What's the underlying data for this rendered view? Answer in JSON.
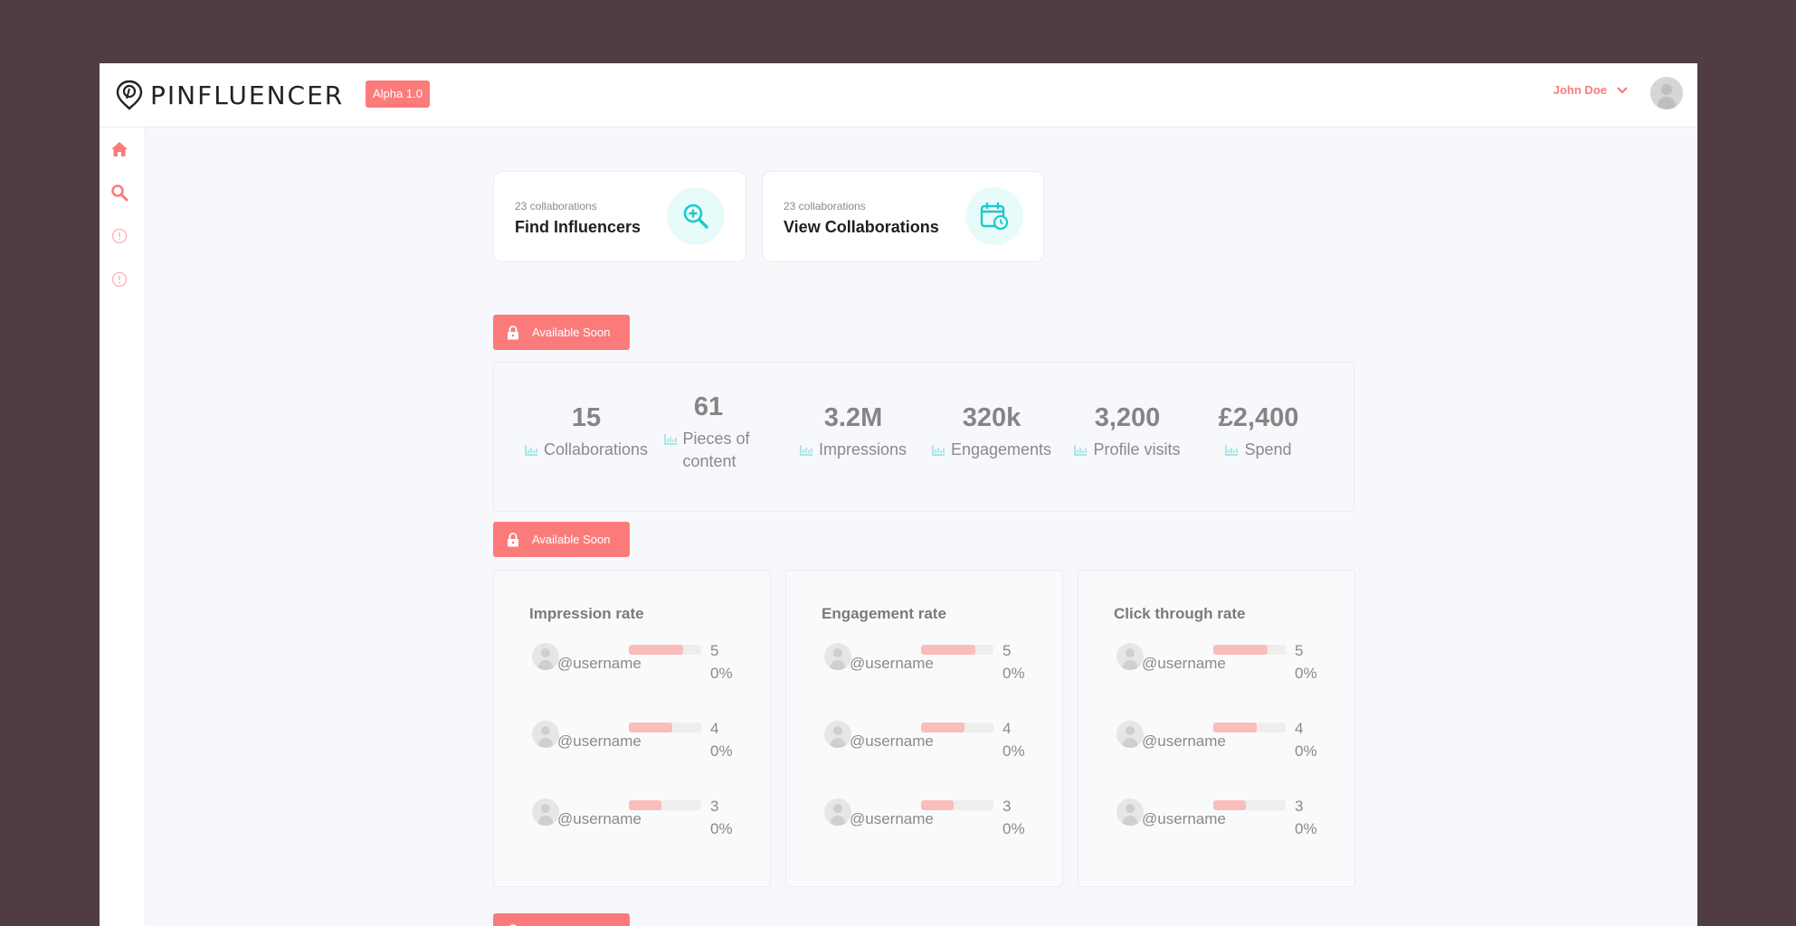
{
  "app": {
    "brand": "PINFLUENCER",
    "version_badge": "Alpha 1.0",
    "user_name": "John Doe"
  },
  "colors": {
    "accent": "#fb7b7b",
    "teal": "#1ec9c9",
    "background": "#4f3d43"
  },
  "sidebar": {
    "items": [
      {
        "icon": "home-icon"
      },
      {
        "icon": "search-icon"
      },
      {
        "icon": "info-icon"
      },
      {
        "icon": "info-icon"
      }
    ]
  },
  "action_cards": [
    {
      "subtitle": "23 collaborations",
      "title": "Find Influencers",
      "icon": "zoom-in-icon"
    },
    {
      "subtitle": "23 collaborations",
      "title": "View Collaborations",
      "icon": "calendar-clock-icon"
    }
  ],
  "available_soon_label": "Available Soon",
  "stats": [
    {
      "value": "15",
      "label": "Collaborations"
    },
    {
      "value": "61",
      "label": "Pieces of content"
    },
    {
      "value": "3.2M",
      "label": "Impressions"
    },
    {
      "value": "320k",
      "label": "Engagements"
    },
    {
      "value": "3,200",
      "label": "Profile visits"
    },
    {
      "value": "£2,400",
      "label": "Spend"
    }
  ],
  "rates": [
    {
      "title": "Impression rate",
      "rows": [
        {
          "username": "@username",
          "percent": 50,
          "percent_label": "50%"
        },
        {
          "username": "@username",
          "percent": 40,
          "percent_label": "40%"
        },
        {
          "username": "@username",
          "percent": 30,
          "percent_label": "30%"
        }
      ]
    },
    {
      "title": "Engagement rate",
      "rows": [
        {
          "username": "@username",
          "percent": 50,
          "percent_label": "50%"
        },
        {
          "username": "@username",
          "percent": 40,
          "percent_label": "40%"
        },
        {
          "username": "@username",
          "percent": 30,
          "percent_label": "30%"
        }
      ]
    },
    {
      "title": "Click through rate",
      "rows": [
        {
          "username": "@username",
          "percent": 50,
          "percent_label": "50%"
        },
        {
          "username": "@username",
          "percent": 40,
          "percent_label": "40%"
        },
        {
          "username": "@username",
          "percent": 30,
          "percent_label": "30%"
        }
      ]
    }
  ]
}
